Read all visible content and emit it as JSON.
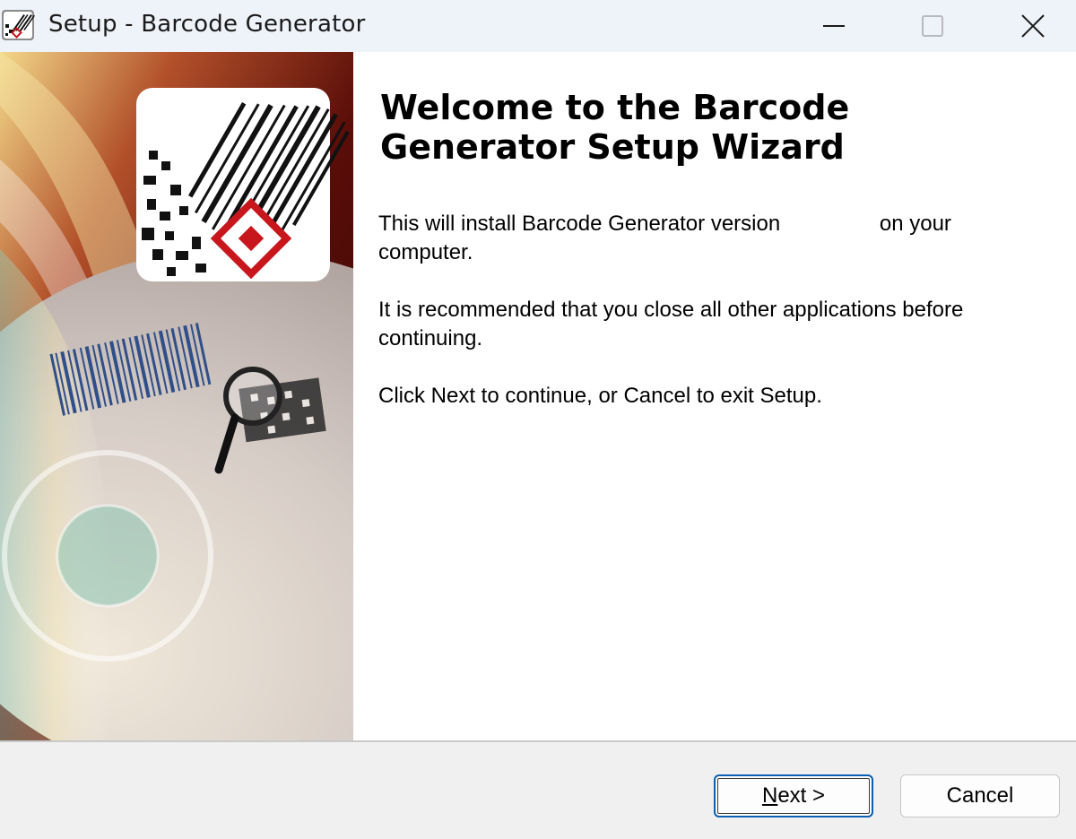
{
  "window": {
    "title": "Setup - Barcode Generator",
    "icon": "barcode-app-icon"
  },
  "titlebar_controls": {
    "minimize": "minimize-icon",
    "maximize": "maximize-icon",
    "close": "close-icon"
  },
  "side_panel": {
    "image": "barcode-generator-artwork"
  },
  "wizard": {
    "heading": "Welcome to the Barcode Generator Setup Wizard",
    "install_text_before": "This will install Barcode Generator version",
    "install_text_after": "on your computer.",
    "recommend_text": "It is recommended that you close all other applications before continuing.",
    "instruction_text": "Click Next to continue, or Cancel to exit Setup."
  },
  "buttons": {
    "next_mnemonic": "N",
    "next_rest": "ext >",
    "cancel": "Cancel"
  },
  "colors": {
    "titlebar_bg": "#eef2f9",
    "footer_bg": "#f0f0f0",
    "focus_border": "#0a5fb4",
    "accent_red": "#c8161d"
  }
}
